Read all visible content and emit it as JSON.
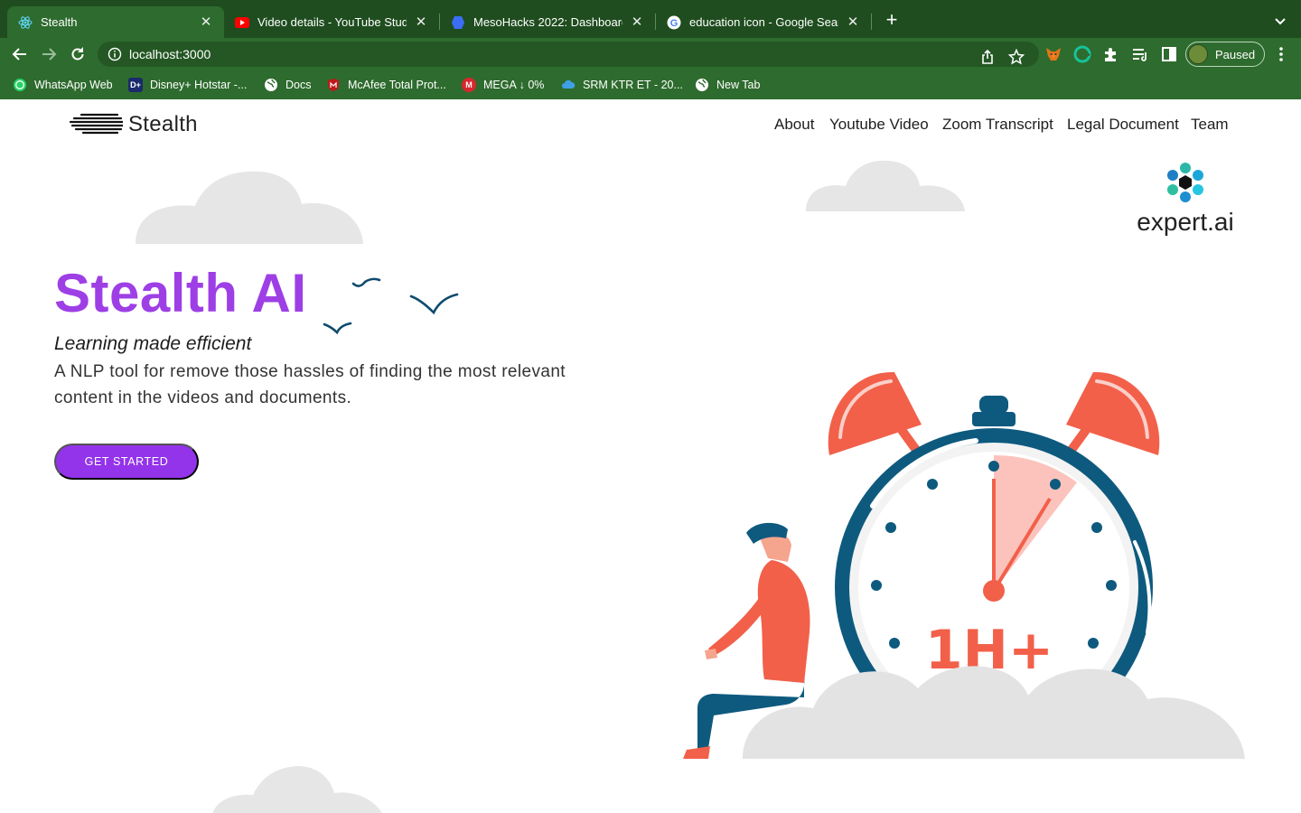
{
  "browser": {
    "tabs": [
      {
        "title": "Stealth",
        "icon": "react-icon",
        "active": true
      },
      {
        "title": "Video details - YouTube Studio",
        "icon": "youtube-icon",
        "active": false
      },
      {
        "title": "MesoHacks 2022: Dashboard |",
        "icon": "devpost-icon",
        "active": false
      },
      {
        "title": "education icon - Google Search",
        "icon": "google-icon",
        "active": false
      }
    ],
    "url": "localhost:3000",
    "profile_status": "Paused",
    "bookmarks": [
      {
        "label": "WhatsApp Web",
        "icon": "whatsapp-icon"
      },
      {
        "label": "Disney+ Hotstar -...",
        "icon": "hotstar-icon"
      },
      {
        "label": "Docs",
        "icon": "globe-icon"
      },
      {
        "label": "McAfee Total Prot...",
        "icon": "mcafee-icon"
      },
      {
        "label": "MEGA ↓ 0%",
        "icon": "mega-icon"
      },
      {
        "label": "SRM KTR ET - 20...",
        "icon": "cloud-icon"
      },
      {
        "label": "New Tab",
        "icon": "globe-icon"
      }
    ],
    "colors": {
      "frame": "#1f4d1f",
      "toolbar": "#2e6b2e"
    }
  },
  "site": {
    "brand": "Stealth",
    "nav": [
      "About",
      "Youtube Video",
      "Zoom Transcript",
      "Legal Document",
      "Team"
    ],
    "hero": {
      "title": "Stealth AI",
      "tagline": "Learning made efficient",
      "description": "A NLP tool for remove those hassles of finding the most relevant content in the videos and documents.",
      "cta": "GET STARTED"
    },
    "partner_logo": "expert.ai",
    "illustration_text": "1H+",
    "colors": {
      "accent": "#9e3fe6",
      "button": "#9333ea",
      "clock_ring": "#0e5a7e",
      "clock_bell": "#f2604a"
    }
  }
}
